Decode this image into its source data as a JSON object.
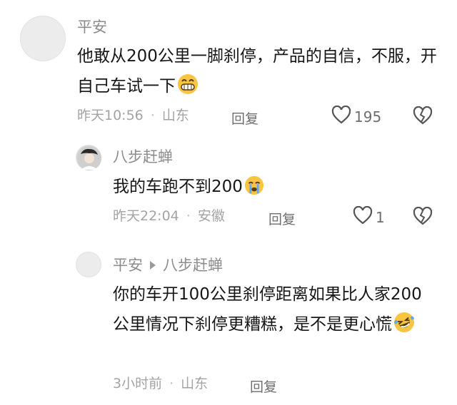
{
  "comments": [
    {
      "author": "平安",
      "text": "他敢从200公里一脚刹停，产品的自信，不服，开自己车试一下",
      "emoji": "grinning-face",
      "time": "昨天10:56",
      "location": "山东",
      "reply_label": "回复",
      "likes": "195",
      "dislike_icon": "broken-heart-icon"
    },
    {
      "author": "八步赶蝉",
      "text": "我的车跑不到200",
      "emoji": "crying-face",
      "time": "昨天22:04",
      "location": "安徽",
      "reply_label": "回复",
      "likes": "1",
      "dislike_icon": "broken-heart-icon"
    },
    {
      "author": "平安",
      "reply_to": "八步赶蝉",
      "text": "你的车开100公里刹停距离如果比人家200公里情况下刹停更糟糕，是不是更心慌",
      "emoji": "laughing-tears-face",
      "time": "3小时前",
      "location": "山东",
      "reply_label": "回复"
    }
  ],
  "colors": {
    "emoji_yellow": "#f7c542",
    "tear_blue": "#5aa9ff",
    "name_gray": "#8c8c8c"
  }
}
